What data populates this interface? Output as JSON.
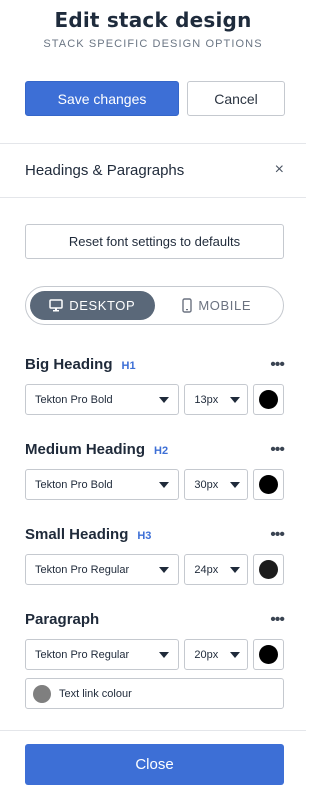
{
  "header": {
    "title": "Edit stack design",
    "subtitle": "STACK SPECIFIC DESIGN OPTIONS"
  },
  "actions": {
    "save_label": "Save changes",
    "cancel_label": "Cancel"
  },
  "section": {
    "title": "Headings & Paragraphs",
    "close_glyph": "×"
  },
  "reset_label": "Reset font settings to defaults",
  "device_toggle": {
    "selected": "desktop",
    "desktop_label": "DESKTOP",
    "mobile_label": "MOBILE"
  },
  "groups": [
    {
      "label": "Big Heading",
      "tag": "H1",
      "font": "Tekton Pro Bold",
      "size": "13px",
      "color": "#000000"
    },
    {
      "label": "Medium Heading",
      "tag": "H2",
      "font": "Tekton Pro Bold",
      "size": "30px",
      "color": "#000000"
    },
    {
      "label": "Small Heading",
      "tag": "H3",
      "font": "Tekton Pro Regular",
      "size": "24px",
      "color": "#1c1c1c"
    },
    {
      "label": "Paragraph",
      "tag": "",
      "font": "Tekton Pro Regular",
      "size": "20px",
      "color": "#000000"
    }
  ],
  "more_glyph": "•••",
  "link_colour": {
    "label": "Text link colour",
    "color": "#7f7f7f"
  },
  "close_label": "Close",
  "colors": {
    "primary": "#3d6fd6",
    "toggle_active": "#5a6879",
    "border": "#c5c9cf"
  }
}
